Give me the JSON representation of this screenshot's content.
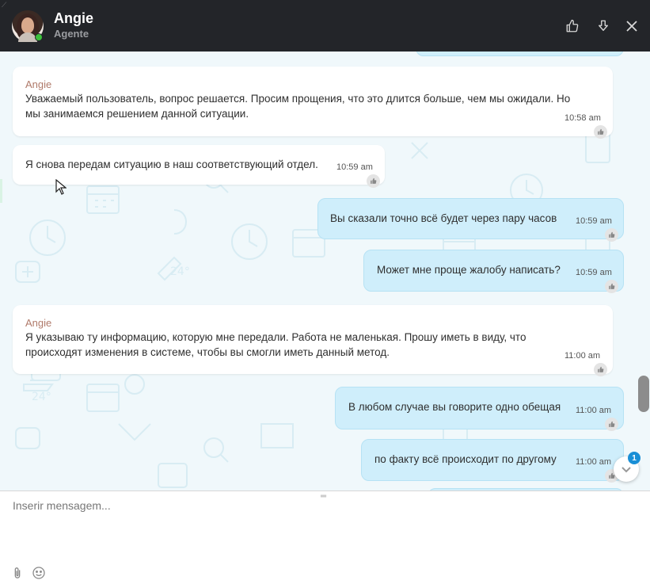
{
  "header": {
    "agent_name": "Angie",
    "agent_role": "Agente",
    "status_color": "#3dc13c"
  },
  "messages": [
    {
      "direction": "in",
      "sender": "Angie",
      "text_lines": [
        "Уважаемый пользователь, вопрос решается. Просим прощения, что это длится больше, чем мы ожидали. Но",
        "мы занимаемся решением данной ситуации."
      ],
      "time": "10:58 am"
    },
    {
      "direction": "in",
      "sender": "",
      "text_lines": [
        "Я снова передам ситуацию в наш соответствующий отдел."
      ],
      "time": "10:59 am"
    },
    {
      "direction": "out",
      "text_lines": [
        "Вы сказали точно всё будет через пару часов"
      ],
      "time": "10:59 am"
    },
    {
      "direction": "out",
      "text_lines": [
        "Может мне проще жалобу написать?"
      ],
      "time": "10:59 am"
    },
    {
      "direction": "in",
      "sender": "Angie",
      "text_lines": [
        "Я указываю ту информацию, которую мне передали. Работа не маленькая. Прошу иметь в виду, что",
        "происходят изменения в системе, чтобы вы смогли иметь данный метод."
      ],
      "time": "11:00 am"
    },
    {
      "direction": "out",
      "text_lines": [
        "В любом случае вы говорите одно обещая"
      ],
      "time": "11:00 am"
    },
    {
      "direction": "out",
      "text_lines": [
        "по факту всё происходит по другому"
      ],
      "time": "11:00 am"
    }
  ],
  "unread_badge": "1",
  "composer": {
    "placeholder": "Inserir mensagem..."
  },
  "colors": {
    "header_bg": "#232529",
    "incoming_bubble": "#ffffff",
    "outgoing_bubble": "#cfeefb",
    "chat_bg": "#f0f8fb",
    "badge": "#1a8fd6"
  },
  "icons": {
    "like": "thumbs-up-icon",
    "download": "download-icon",
    "close": "close-icon",
    "attach": "paperclip-icon",
    "emoji": "emoji-icon",
    "scroll_down": "chevron-down-icon"
  }
}
